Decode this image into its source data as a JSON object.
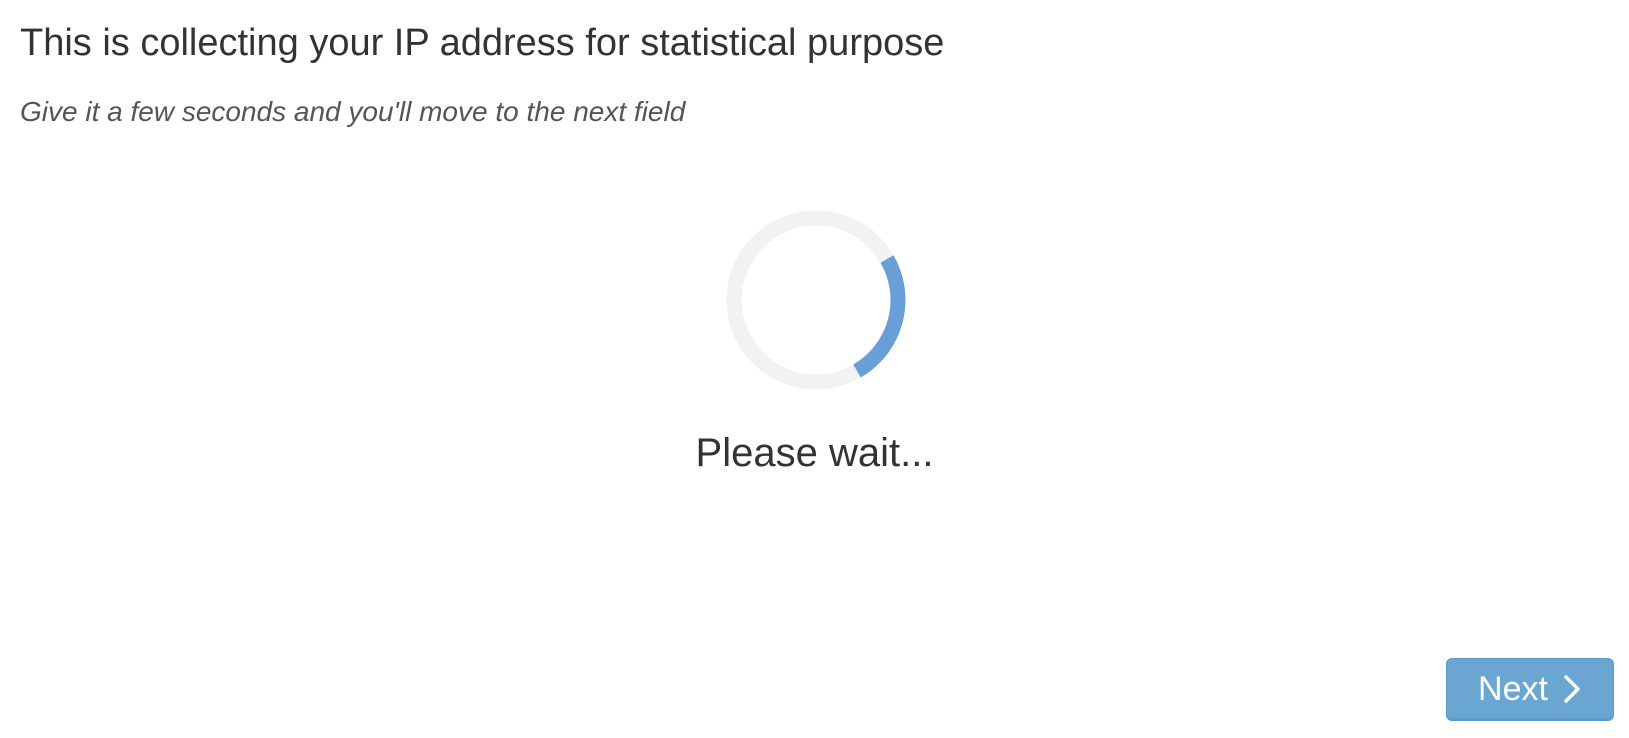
{
  "question": {
    "title": "This is collecting your IP address for statistical purpose",
    "description": "Give it a few seconds and you'll move to the next field"
  },
  "loading": {
    "status_text": "Please wait...",
    "spinner_icon": "loading-spinner-icon",
    "track_color": "#f2f2f2",
    "arc_color": "#6a9ed9"
  },
  "navigation": {
    "next_label": "Next",
    "next_icon": "chevron-right-icon",
    "button_color": "#6ba6d2"
  }
}
